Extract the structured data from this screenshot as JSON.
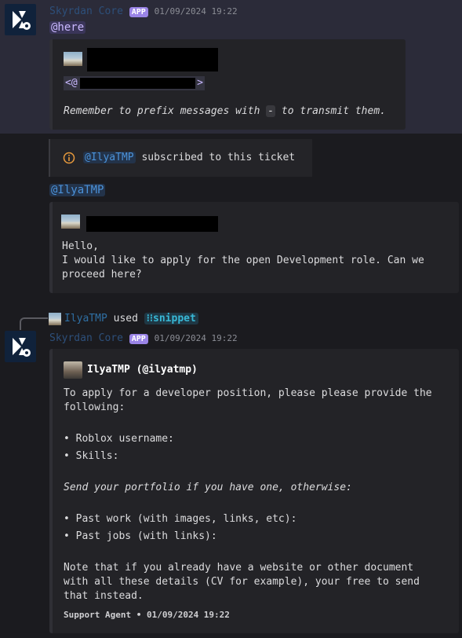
{
  "message1": {
    "author": "Skyrdan Core",
    "badge": "APP",
    "timestamp": "01/09/2024 19:22",
    "mention": "@here",
    "embed": {
      "mention_prefix": "<@",
      "mention_suffix": ">",
      "note_before": "Remember to prefix messages with ",
      "note_code": "-",
      "note_after": " to transmit them."
    }
  },
  "system": {
    "icon": "info-icon",
    "user": "@IlyaTMP",
    "text": "subscribed to this ticket"
  },
  "message2": {
    "mention": "@IlyaTMP",
    "embed": {
      "line1": "Hello,",
      "line2": "I would like to apply for the open Development role. Can we",
      "line3": "proceed here?"
    }
  },
  "message3": {
    "reply_user": "IlyaTMP",
    "reply_used": "used",
    "command": "snippet",
    "author": "Skyrdan Core",
    "badge": "APP",
    "timestamp": "01/09/2024 19:22",
    "embed": {
      "author": "IlyaTMP (@ilyatmp)",
      "intro1": "To apply for a developer position, please please provide the",
      "intro2": "following:",
      "list1": [
        "Roblox username:",
        "Skills:"
      ],
      "portfolio": "Send your portfolio if you have one, otherwise:",
      "list2": [
        "Past work (with images, links, etc):",
        "Past jobs (with links):"
      ],
      "note1": "Note that if you already have a website or other document",
      "note2": "with all these details (CV for example), your free to send",
      "note3": "that instead.",
      "footer": "Support Agent • 01/09/2024 19:22"
    }
  }
}
